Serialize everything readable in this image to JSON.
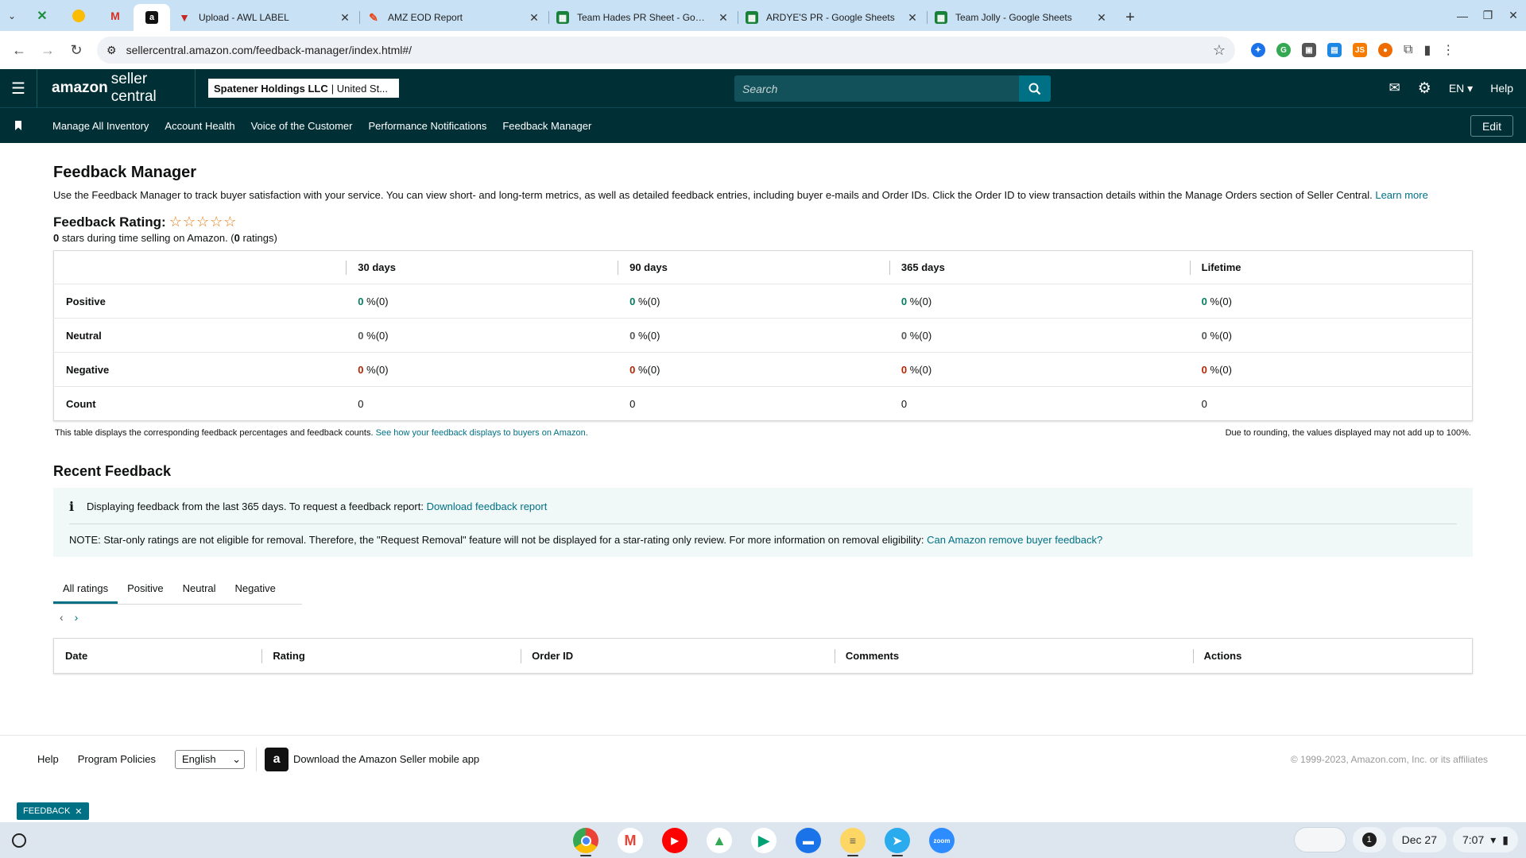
{
  "browser": {
    "tabs": [
      {
        "title": "Upload - AWL LABEL",
        "icon": "awl-favicon-icon",
        "color": "#c62828"
      },
      {
        "title": "AMZ EOD Report",
        "icon": "report-favicon-icon",
        "color": "#e64a19"
      },
      {
        "title": "Team Hades PR Sheet - Google",
        "icon": "sheets-favicon-icon",
        "color": "#188038"
      },
      {
        "title": "ARDYE'S PR - Google Sheets",
        "icon": "sheets-favicon-icon",
        "color": "#188038"
      },
      {
        "title": "Team Jolly - Google Sheets",
        "icon": "sheets-favicon-icon",
        "color": "#188038"
      }
    ],
    "url": "sellercentral.amazon.com/feedback-manager/index.html#/"
  },
  "header": {
    "logo_main": "amazon",
    "logo_sub": "seller central",
    "account_name": "Spatener Holdings LLC",
    "account_region": "| United St...",
    "search_placeholder": "Search",
    "language": "EN",
    "help": "Help"
  },
  "subnav": {
    "items": [
      "Manage All Inventory",
      "Account Health",
      "Voice of the Customer",
      "Performance Notifications",
      "Feedback Manager"
    ],
    "edit": "Edit"
  },
  "page": {
    "title": "Feedback Manager",
    "description": "Use the Feedback Manager to track buyer satisfaction with your service. You can view short- and long-term metrics, as well as detailed feedback entries, including buyer e-mails and Order IDs. Click the Order ID to view transaction details within the Manage Orders section of Seller Central.",
    "learn_more": "Learn more",
    "rating_label": "Feedback Rating:",
    "stars": "☆☆☆☆☆",
    "stars_value": "0",
    "stars_text": "stars during time selling on Amazon. (",
    "ratings_count": "0",
    "ratings_text": "ratings)"
  },
  "metrics": {
    "columns": [
      "30 days",
      "90 days",
      "365 days",
      "Lifetime"
    ],
    "rows": [
      {
        "label": "Positive",
        "values": [
          "0",
          "0",
          "0",
          "0"
        ],
        "suffix": "%(0)"
      },
      {
        "label": "Neutral",
        "values": [
          "0",
          "0",
          "0",
          "0"
        ],
        "suffix": "%(0)"
      },
      {
        "label": "Negative",
        "values": [
          "0",
          "0",
          "0",
          "0"
        ],
        "suffix": "%(0)"
      },
      {
        "label": "Count",
        "values": [
          "0",
          "0",
          "0",
          "0"
        ],
        "suffix": ""
      }
    ],
    "note_left": "This table displays the corresponding feedback percentages and feedback counts.",
    "note_left_link": "See how your feedback displays to buyers on Amazon.",
    "note_right": "Due to rounding, the values displayed may not add up to 100%."
  },
  "recent": {
    "title": "Recent Feedback",
    "info_text": "Displaying feedback from the last 365 days. To request a feedback report:",
    "info_link": "Download feedback report",
    "note_text": "NOTE: Star-only ratings are not eligible for removal. Therefore, the \"Request Removal\" feature will not be displayed for a star-rating only review. For more information on removal eligibility:",
    "note_link": "Can Amazon remove buyer feedback?",
    "tabs": [
      "All ratings",
      "Positive",
      "Neutral",
      "Negative"
    ],
    "table_columns": [
      "Date",
      "Rating",
      "Order ID",
      "Comments",
      "Actions"
    ]
  },
  "footer": {
    "help": "Help",
    "policies": "Program Policies",
    "language": "English",
    "app_download": "Download the Amazon Seller mobile app",
    "copyright": "© 1999-2023, Amazon.com, Inc. or its affiliates"
  },
  "feedback_chip": "FEEDBACK",
  "shelf": {
    "notification_count": "1",
    "date": "Dec 27",
    "time": "7:07"
  },
  "colors": {
    "header_bg": "#002f36",
    "link": "#007185",
    "positive": "#067d62",
    "negative": "#b12704"
  }
}
